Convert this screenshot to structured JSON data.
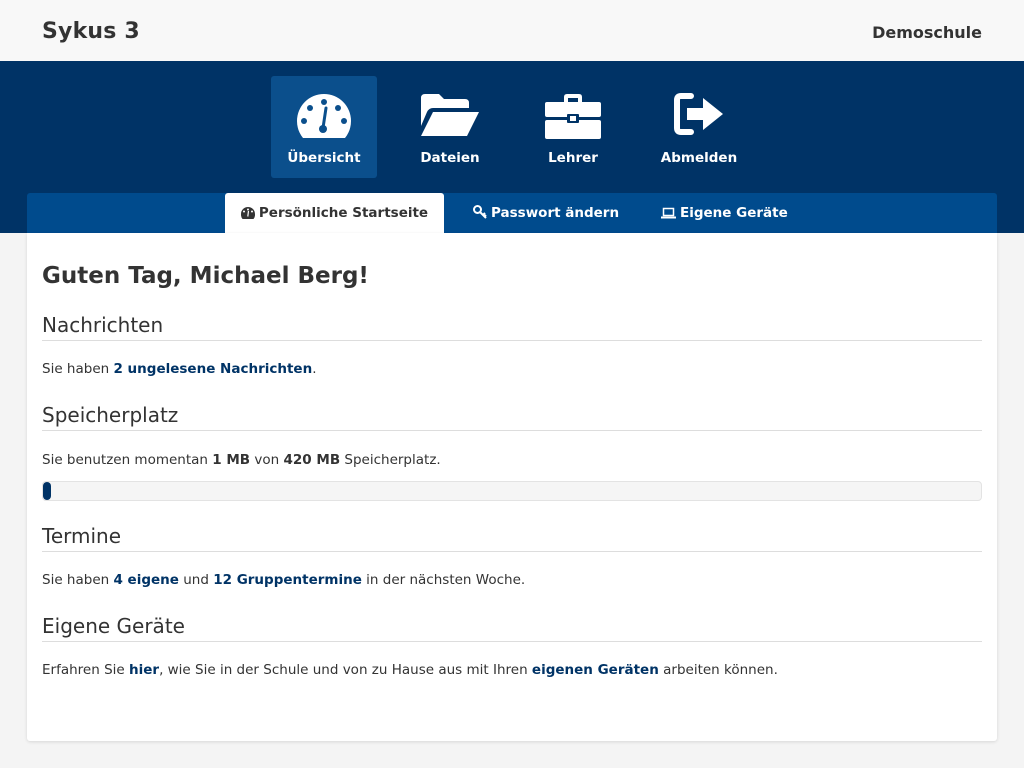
{
  "header": {
    "brand": "Sykus 3",
    "school": "Demoschule"
  },
  "nav": {
    "items": [
      {
        "label": "Übersicht",
        "icon": "dashboard-icon",
        "active": true
      },
      {
        "label": "Dateien",
        "icon": "folder-open-icon",
        "active": false
      },
      {
        "label": "Lehrer",
        "icon": "briefcase-icon",
        "active": false
      },
      {
        "label": "Abmelden",
        "icon": "sign-out-icon",
        "active": false
      }
    ]
  },
  "tabs": [
    {
      "label": "Persönliche Startseite",
      "icon": "dashboard-icon",
      "active": true
    },
    {
      "label": "Passwort ändern",
      "icon": "key-icon",
      "active": false
    },
    {
      "label": "Eigene Geräte",
      "icon": "laptop-icon",
      "active": false
    }
  ],
  "main": {
    "greeting": "Guten Tag, Michael Berg!",
    "messages": {
      "heading": "Nachrichten",
      "pre": "Sie haben ",
      "link": "2 ungelesene Nachrichten",
      "post": "."
    },
    "storage": {
      "heading": "Speicherplatz",
      "pre": "Sie benutzen momentan ",
      "used": "1 MB",
      "mid": " von ",
      "total": "420 MB",
      "post": " Speicherplatz.",
      "fraction": 0.0024
    },
    "appointments": {
      "heading": "Termine",
      "pre": "Sie haben ",
      "own_link": "4 eigene",
      "mid": " und ",
      "group_link": "12 Gruppentermine",
      "post": " in der nächsten Woche."
    },
    "devices": {
      "heading": "Eigene Geräte",
      "pre": "Erfahren Sie ",
      "here_link": "hier",
      "mid": ", wie Sie in der Schule und von zu Hause aus mit Ihren ",
      "devices_link": "eigenen Geräten",
      "post": " arbeiten können."
    }
  },
  "colors": {
    "nav_bg": "#003366",
    "nav_active": "#0b4f8c",
    "tabbar_bg": "#004b8d",
    "link": "#003366"
  }
}
